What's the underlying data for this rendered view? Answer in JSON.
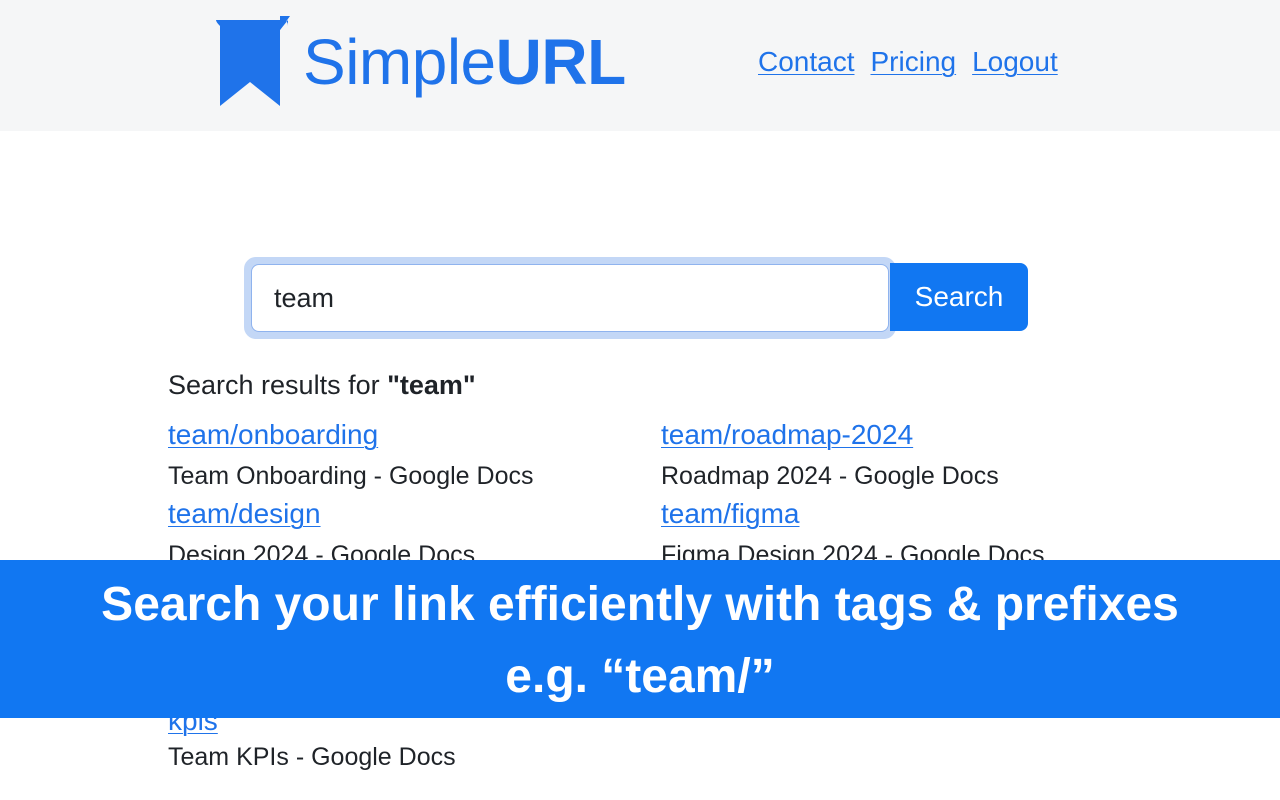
{
  "header": {
    "logo_icon": "bookmark-icon",
    "logo_text_regular": "Simple",
    "logo_text_bold": "URL",
    "nav": [
      {
        "label": "Contact"
      },
      {
        "label": "Pricing"
      },
      {
        "label": "Logout"
      }
    ]
  },
  "search": {
    "value": "team",
    "button_label": "Search"
  },
  "results": {
    "heading_prefix": "Search results for ",
    "heading_query": "\"team\"",
    "items": [
      {
        "link": "team/onboarding",
        "title": "Team Onboarding - Google Docs"
      },
      {
        "link": "team/roadmap-2024",
        "title": "Roadmap 2024 - Google Docs"
      },
      {
        "link": "team/design",
        "title": "Design 2024 - Google Docs"
      },
      {
        "link": "team/figma",
        "title": "Figma Design 2024 - Google Docs"
      },
      {
        "link": "kpis",
        "title": "Team KPIs - Google Docs"
      }
    ]
  },
  "banner": {
    "line1": "Search your link efficiently with tags & prefixes",
    "line2": "e.g. “team/”"
  },
  "colors": {
    "brand": "#1f73ea",
    "button": "#1177f2",
    "banner": "#1177f2",
    "header_bg": "#f5f6f7"
  }
}
